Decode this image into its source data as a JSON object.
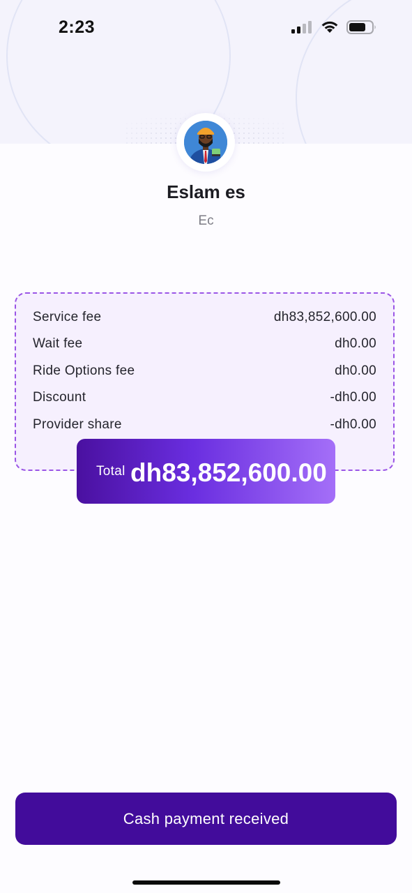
{
  "status_bar": {
    "time": "2:23",
    "icons": [
      "cellular-signal-icon",
      "wifi-icon",
      "battery-icon"
    ]
  },
  "profile": {
    "avatar_icon": "avatar-illustration",
    "name": "Eslam es",
    "subtitle": "Ec"
  },
  "fees": {
    "rows": [
      {
        "label": "Service fee",
        "value": "dh83,852,600.00"
      },
      {
        "label": "Wait fee",
        "value": "dh0.00"
      },
      {
        "label": "Ride Options fee",
        "value": "dh0.00"
      },
      {
        "label": "Discount",
        "value": "-dh0.00"
      },
      {
        "label": "Provider share",
        "value": "-dh0.00"
      }
    ]
  },
  "total": {
    "label": "Total",
    "value": "dh83,852,600.00"
  },
  "actions": {
    "cash_received_label": "Cash payment received"
  },
  "colors": {
    "primary": "#420c9b",
    "accent_dashed_border": "#9a55e6",
    "card_background": "#f6f0fe",
    "header_background": "#f4f3fc"
  }
}
